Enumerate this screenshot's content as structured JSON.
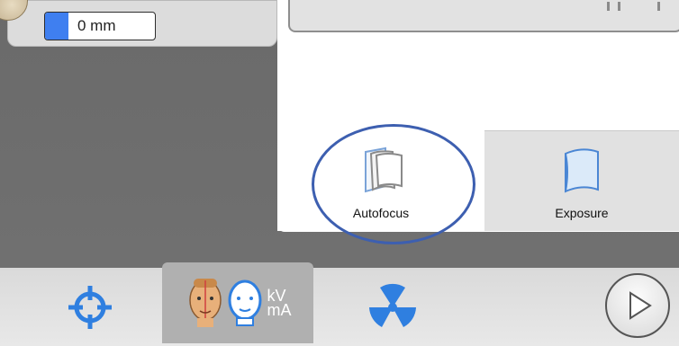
{
  "stepper": {
    "value": "0 mm",
    "fill_color": "#3f7ff0"
  },
  "tabs": [
    {
      "label": "Autofocus",
      "icon": "autofocus-icon",
      "selected": true
    },
    {
      "label": "Exposure",
      "icon": "exposure-icon",
      "selected": false
    }
  ],
  "toolbar": {
    "target_icon": "crosshair-icon",
    "patient_icon": "patient-head-icon",
    "kv_label": "kV",
    "ma_label": "mA",
    "radiation_icon": "radiation-icon",
    "next_icon": "play-next-icon"
  },
  "colors": {
    "accent_blue": "#3f7ff0",
    "highlight_ring": "#3d5fb0",
    "background_gray": "#6e6e6e"
  }
}
